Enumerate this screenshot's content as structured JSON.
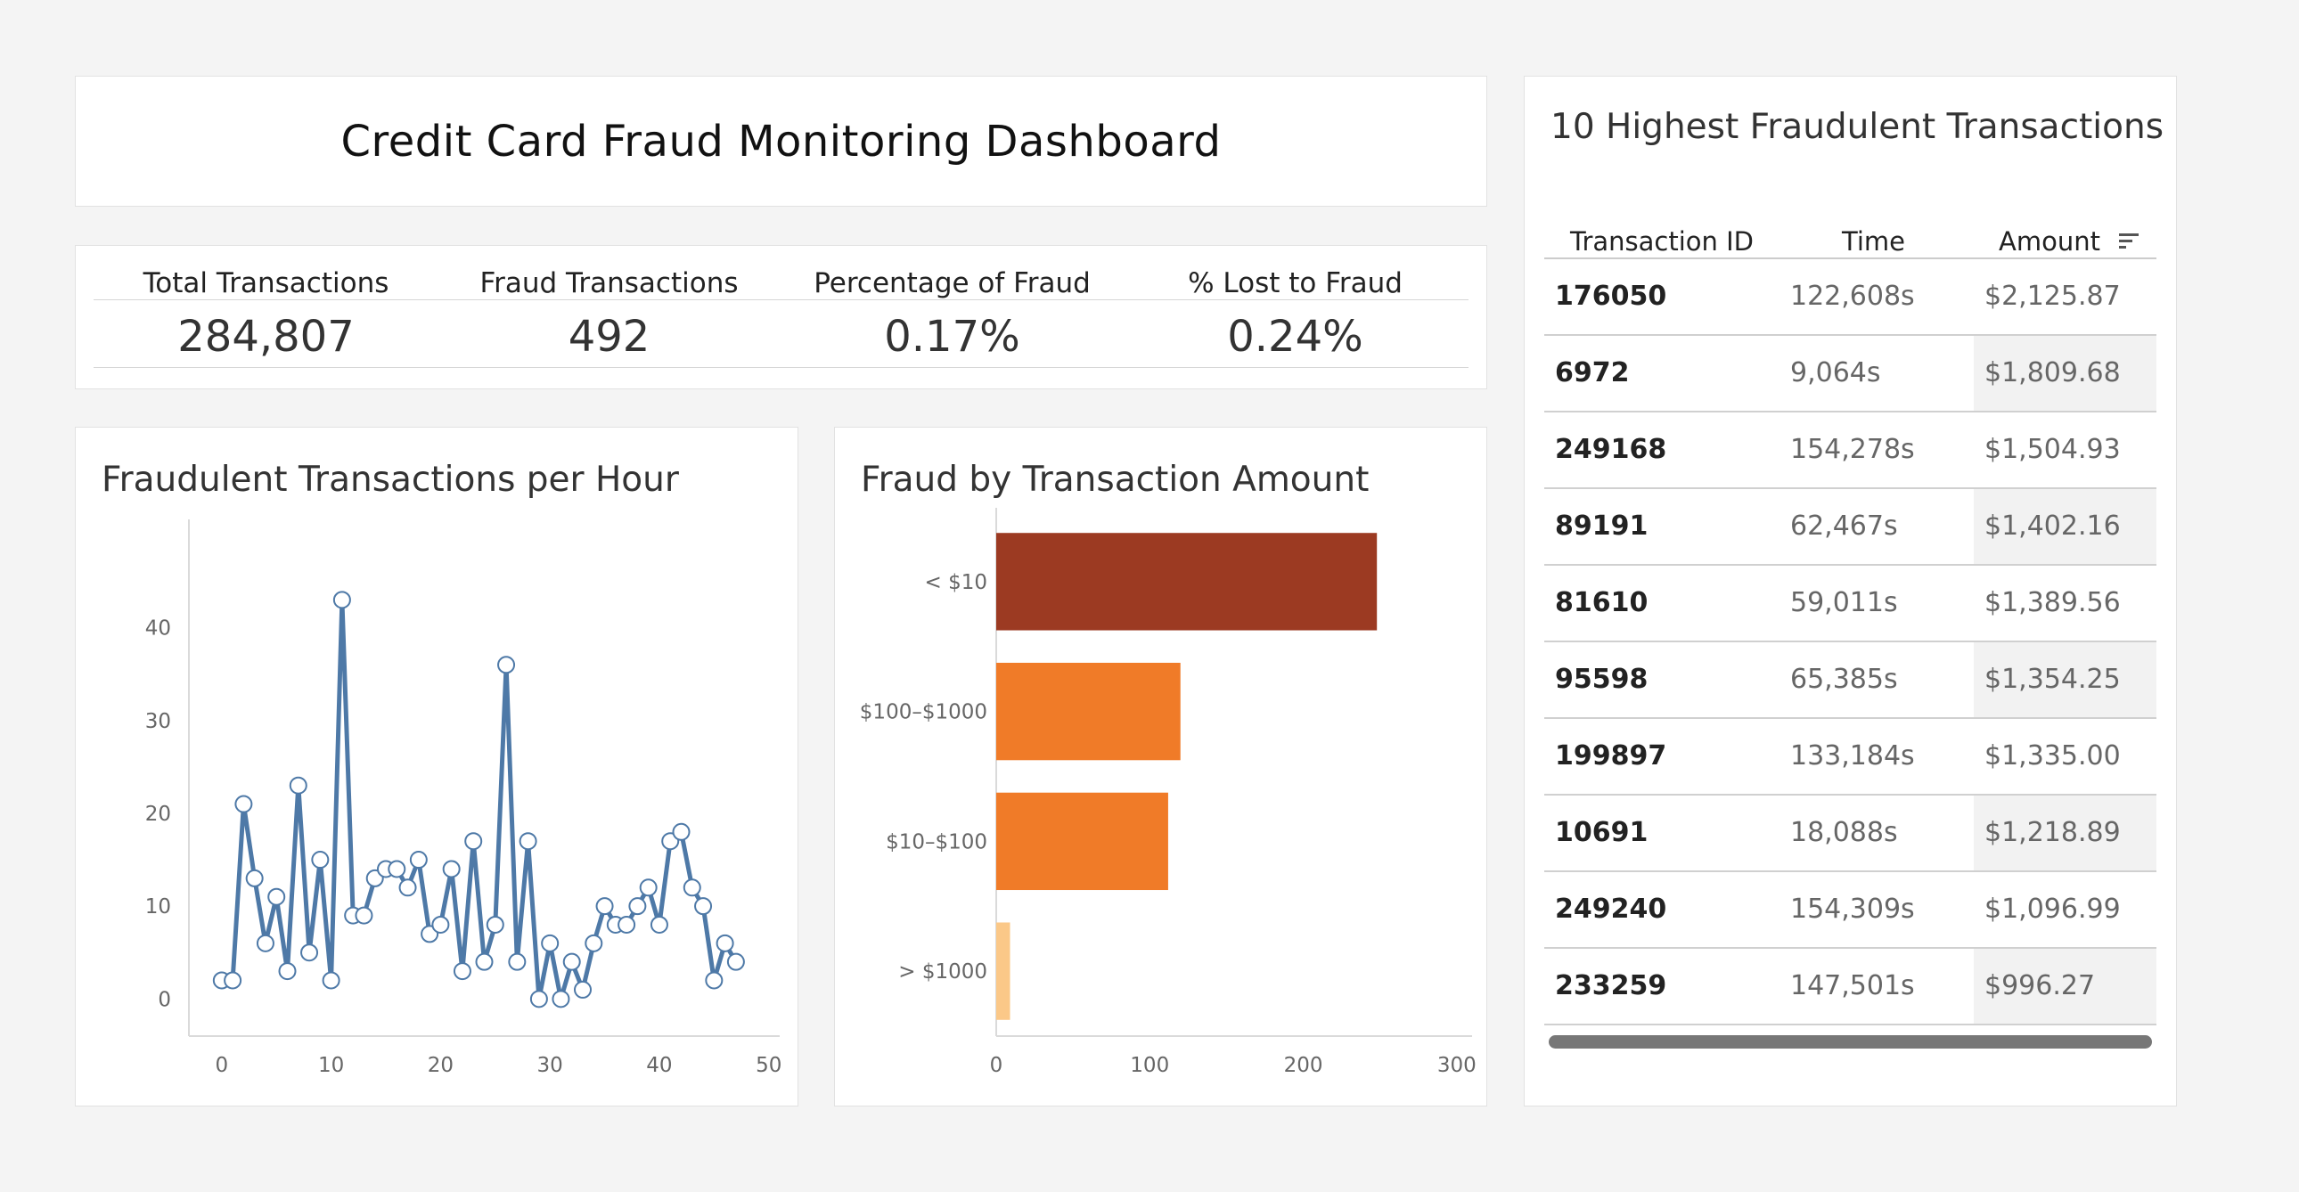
{
  "dashboard_title": "Credit Card Fraud Monitoring Dashboard",
  "kpis": [
    {
      "label": "Total Transactions",
      "value": "284,807"
    },
    {
      "label": "Fraud Transactions",
      "value": "492"
    },
    {
      "label": "Percentage of Fraud",
      "value": "0.17%"
    },
    {
      "label": "% Lost to Fraud",
      "value": "0.24%"
    }
  ],
  "line_chart": {
    "title": "Fraudulent Transactions per Hour"
  },
  "bar_chart": {
    "title": "Fraud by Transaction Amount"
  },
  "table": {
    "title": "10 Highest Fraudulent Transactions",
    "columns": [
      "Transaction ID",
      "Time",
      "Amount"
    ],
    "sort_icon": "sort-descending-icon",
    "rows": [
      {
        "id": "176050",
        "time": "122,608s",
        "amount": "$2,125.87"
      },
      {
        "id": "6972",
        "time": "9,064s",
        "amount": "$1,809.68"
      },
      {
        "id": "249168",
        "time": "154,278s",
        "amount": "$1,504.93"
      },
      {
        "id": "89191",
        "time": "62,467s",
        "amount": "$1,402.16"
      },
      {
        "id": "81610",
        "time": "59,011s",
        "amount": "$1,389.56"
      },
      {
        "id": "95598",
        "time": "65,385s",
        "amount": "$1,354.25"
      },
      {
        "id": "199897",
        "time": "133,184s",
        "amount": "$1,335.00"
      },
      {
        "id": "10691",
        "time": "18,088s",
        "amount": "$1,218.89"
      },
      {
        "id": "249240",
        "time": "154,309s",
        "amount": "$1,096.99"
      },
      {
        "id": "233259",
        "time": "147,501s",
        "amount": "$996.27"
      }
    ]
  },
  "chart_data": [
    {
      "type": "line",
      "title": "Fraudulent Transactions per Hour",
      "xlabel": "",
      "ylabel": "",
      "x": [
        0,
        1,
        2,
        3,
        4,
        5,
        6,
        7,
        8,
        9,
        10,
        11,
        12,
        13,
        14,
        15,
        16,
        17,
        18,
        19,
        20,
        21,
        22,
        23,
        24,
        25,
        26,
        27,
        28,
        29,
        30,
        31,
        32,
        33,
        34,
        35,
        36,
        37,
        38,
        39,
        40,
        41,
        42,
        43,
        44,
        45,
        46,
        47
      ],
      "series": [
        {
          "values": [
            2,
            2,
            21,
            13,
            6,
            11,
            3,
            23,
            5,
            15,
            2,
            43,
            9,
            9,
            13,
            14,
            14,
            12,
            15,
            7,
            8,
            14,
            3,
            17,
            4,
            8,
            36,
            4,
            17,
            0,
            6,
            0,
            4,
            1,
            6,
            10,
            8,
            8,
            10,
            12,
            8,
            17,
            18,
            12,
            10,
            2,
            6,
            4
          ]
        }
      ],
      "xlim": [
        -3,
        51
      ],
      "ylim": [
        -4,
        51
      ],
      "xticks": [
        0,
        10,
        20,
        30,
        40,
        50
      ],
      "yticks": [
        0,
        10,
        20,
        30,
        40
      ],
      "grid": false,
      "color": "#4e79a7"
    },
    {
      "type": "bar",
      "orientation": "horizontal",
      "title": "Fraud by Transaction Amount",
      "categories": [
        "< $10",
        "$100–$1000",
        "$10–$100",
        "> $1000"
      ],
      "values": [
        248,
        120,
        112,
        9
      ],
      "colors": [
        "#9c3a22",
        "#f07b28",
        "#f07b28",
        "#fbc888"
      ],
      "xlim": [
        0,
        310
      ],
      "xticks": [
        0,
        100,
        200,
        300
      ],
      "grid": false
    }
  ]
}
